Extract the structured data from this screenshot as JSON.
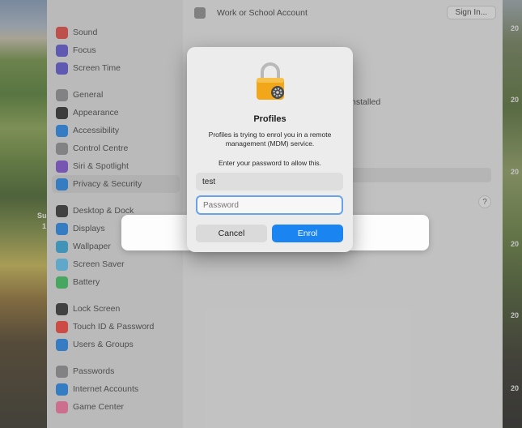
{
  "wallpaper": {
    "right_labels": [
      "20",
      "20",
      "20",
      "20",
      "20",
      "20"
    ],
    "left_label_1": "Su",
    "left_label_2": "1"
  },
  "sidebar": {
    "groups": [
      [
        {
          "label": "Sound",
          "icon": "speaker-icon",
          "color": "#e8413a"
        },
        {
          "label": "Focus",
          "icon": "moon-icon",
          "color": "#5a4fd6"
        },
        {
          "label": "Screen Time",
          "icon": "hourglass-icon",
          "color": "#5a4fd6"
        }
      ],
      [
        {
          "label": "General",
          "icon": "gear-icon",
          "color": "#8e8e93"
        },
        {
          "label": "Appearance",
          "icon": "appearance-icon",
          "color": "#222222"
        },
        {
          "label": "Accessibility",
          "icon": "accessibility-icon",
          "color": "#1a84f0"
        },
        {
          "label": "Control Centre",
          "icon": "control-centre-icon",
          "color": "#8e8e93"
        },
        {
          "label": "Siri & Spotlight",
          "icon": "siri-icon",
          "color": "#7b4bd6"
        },
        {
          "label": "Privacy & Security",
          "icon": "hand-icon",
          "color": "#1a84f0",
          "selected": true
        }
      ],
      [
        {
          "label": "Desktop & Dock",
          "icon": "dock-icon",
          "color": "#2a2a2a"
        },
        {
          "label": "Displays",
          "icon": "display-icon",
          "color": "#1a84f0"
        },
        {
          "label": "Wallpaper",
          "icon": "wallpaper-icon",
          "color": "#2aa8e0"
        },
        {
          "label": "Screen Saver",
          "icon": "screensaver-icon",
          "color": "#5ac8fa"
        },
        {
          "label": "Battery",
          "icon": "battery-icon",
          "color": "#34c759"
        }
      ],
      [
        {
          "label": "Lock Screen",
          "icon": "lock-screen-icon",
          "color": "#2a2a2a"
        },
        {
          "label": "Touch ID & Password",
          "icon": "fingerprint-icon",
          "color": "#ff3b30"
        },
        {
          "label": "Users & Groups",
          "icon": "users-icon",
          "color": "#1a84f0"
        }
      ],
      [
        {
          "label": "Passwords",
          "icon": "key-icon",
          "color": "#8e8e93"
        },
        {
          "label": "Internet Accounts",
          "icon": "at-icon",
          "color": "#1a84f0"
        },
        {
          "label": "Game Center",
          "icon": "game-center-icon",
          "color": "#ff6fa0"
        }
      ]
    ]
  },
  "main": {
    "account_row_label": "Work or School Account",
    "sign_in_label": "Sign In...",
    "installed_label": "nstalled",
    "help_label": "?"
  },
  "dialog": {
    "title": "Profiles",
    "message": "Profiles is trying to enrol you in a remote management (MDM) service.",
    "prompt": "Enter your password to allow this.",
    "username": "test",
    "password_placeholder": "Password",
    "cancel_label": "Cancel",
    "enrol_label": "Enrol",
    "colors": {
      "accent": "#1a84f0",
      "focus_ring": "#6aa2ea",
      "lock_gold": "#f2a71b"
    }
  }
}
